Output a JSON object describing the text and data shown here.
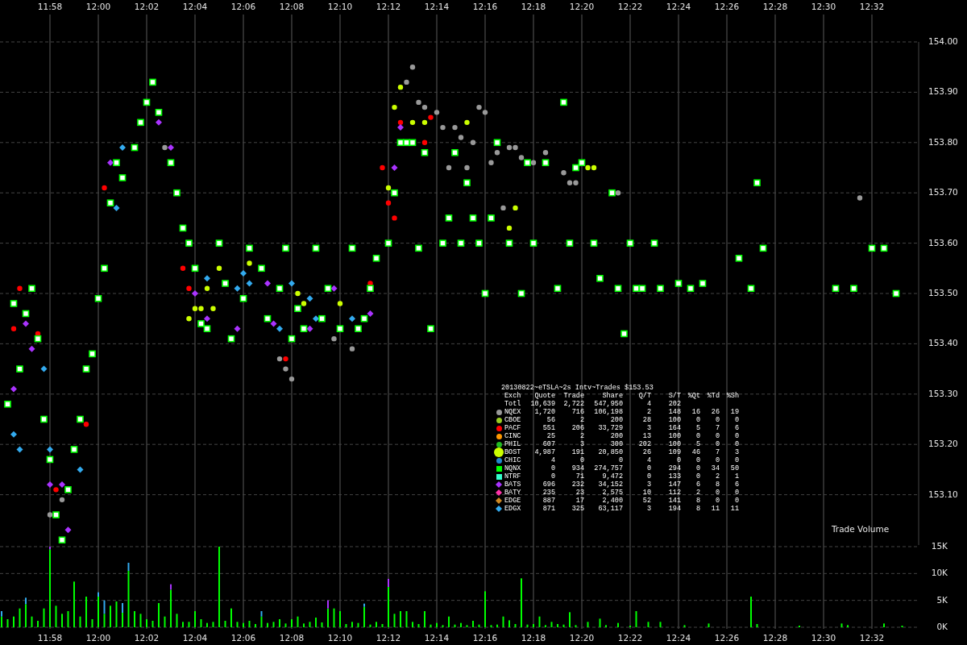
{
  "price_chart": {
    "chart_data": {
      "type": "scatter",
      "grid": true,
      "ylim": [
        153.0,
        154.0
      ],
      "categories": [
        null,
        null,
        null,
        null,
        null,
        null,
        null,
        null,
        "11:58",
        null,
        null,
        null,
        null,
        null,
        null,
        null,
        "12:00",
        null,
        null,
        null,
        null,
        null,
        null,
        null,
        "12:02",
        null,
        null,
        null,
        null,
        null,
        null,
        null,
        "12:04",
        null,
        null,
        null,
        null,
        null,
        null,
        null,
        "12:06",
        null,
        null,
        null,
        null,
        null,
        null,
        null,
        "12:08",
        null,
        null,
        null,
        null,
        null,
        null,
        null,
        "12:10",
        null,
        null,
        null,
        null,
        null,
        null,
        null,
        "12:12",
        null,
        null,
        null,
        null,
        null,
        null,
        null,
        "12:14",
        null,
        null,
        null,
        null,
        null,
        null,
        null,
        "12:16",
        null,
        null,
        null,
        null,
        null,
        null,
        null,
        "12:18",
        null,
        null,
        null,
        null,
        null,
        null,
        null,
        "12:20",
        null,
        null,
        null,
        null,
        null,
        null,
        null,
        "12:22",
        null,
        null,
        null,
        null,
        null,
        null,
        null,
        "12:24",
        null,
        null,
        null,
        null,
        null,
        null,
        null,
        "12:26",
        null,
        null,
        null,
        null,
        null,
        null,
        null,
        "12:28",
        null,
        null,
        null,
        null,
        null,
        null,
        null,
        "12:30",
        null,
        null,
        null,
        null,
        null,
        null,
        null,
        "12:32",
        null,
        null,
        null,
        null,
        null,
        null,
        null
      ],
      "yticks": [
        {
          "value": 154.0,
          "label": "154.00"
        },
        {
          "value": 153.9,
          "label": "153.90"
        },
        {
          "value": 153.8,
          "label": "153.80"
        },
        {
          "value": 153.7,
          "label": "153.70"
        },
        {
          "value": 153.6,
          "label": "153.60"
        },
        {
          "value": 153.5,
          "label": "153.50"
        },
        {
          "value": 153.4,
          "label": "153.40"
        },
        {
          "value": 153.3,
          "label": "153.30"
        },
        {
          "value": 153.2,
          "label": "153.20"
        },
        {
          "value": 153.1,
          "label": "153.10"
        }
      ],
      "series": [
        {
          "color": "#999999",
          "marker": "circle",
          "values": [
            null,
            null,
            null,
            null,
            null,
            null,
            null,
            null,
            153.06,
            null,
            153.09,
            null,
            null,
            null,
            null,
            null,
            null,
            null,
            null,
            null,
            null,
            null,
            null,
            null,
            null,
            null,
            null,
            153.79,
            null,
            null,
            null,
            null,
            null,
            null,
            null,
            null,
            null,
            null,
            null,
            null,
            null,
            null,
            null,
            null,
            null,
            null,
            153.37,
            153.35,
            153.33,
            null,
            null,
            null,
            null,
            null,
            null,
            153.41,
            null,
            null,
            153.39,
            null,
            null,
            null,
            null,
            null,
            null,
            null,
            null,
            153.92,
            153.95,
            153.88,
            153.87,
            null,
            153.86,
            153.83,
            153.75,
            153.83,
            153.81,
            153.75,
            153.8,
            153.87,
            153.86,
            153.76,
            153.78,
            153.67,
            153.79,
            153.79,
            153.77,
            null,
            153.76,
            null,
            153.78,
            null,
            null,
            153.74,
            153.72,
            153.72,
            null,
            null,
            null,
            null,
            null,
            null,
            153.7,
            null,
            null,
            null,
            null,
            null,
            null,
            null,
            null,
            null,
            null,
            null,
            null,
            null,
            null,
            null,
            null,
            null,
            null,
            null,
            null,
            null,
            null,
            null,
            null,
            null,
            null,
            null,
            null,
            null,
            null,
            null,
            null,
            null,
            null,
            null,
            null,
            null,
            null,
            null,
            153.69,
            null,
            null,
            null,
            null,
            null,
            null,
            null,
            null,
            null
          ]
        },
        {
          "color": "#ff0000",
          "marker": "circle",
          "values": [
            null,
            null,
            153.43,
            153.51,
            null,
            null,
            153.42,
            null,
            null,
            153.11,
            null,
            null,
            null,
            null,
            153.24,
            null,
            null,
            153.71,
            null,
            null,
            null,
            null,
            null,
            null,
            null,
            null,
            null,
            null,
            null,
            null,
            153.55,
            153.51,
            null,
            null,
            null,
            null,
            null,
            null,
            null,
            null,
            null,
            null,
            null,
            null,
            null,
            null,
            null,
            153.37,
            null,
            null,
            null,
            null,
            null,
            null,
            null,
            null,
            null,
            null,
            null,
            null,
            null,
            153.52,
            null,
            153.75,
            153.68,
            153.65,
            153.84,
            null,
            null,
            null,
            153.8,
            153.85,
            null,
            null,
            null,
            null,
            null,
            null,
            null,
            null,
            null,
            null,
            null,
            null,
            null,
            null,
            null,
            null,
            null,
            null,
            null,
            null,
            null,
            null,
            null,
            null,
            null,
            null,
            null,
            null,
            null,
            null,
            null,
            null,
            null,
            null,
            null,
            null,
            null,
            null,
            null,
            null,
            null,
            null,
            null,
            null,
            null,
            null,
            null,
            null,
            null,
            null,
            null,
            null,
            null,
            null,
            null,
            null,
            null,
            null,
            null,
            null,
            null,
            null,
            null,
            null,
            null,
            null,
            null,
            null,
            null,
            null,
            null,
            null,
            null,
            null,
            null,
            null,
            null,
            null,
            null,
            null
          ]
        },
        {
          "color": "#ccff00",
          "marker": "circle",
          "values": [
            null,
            null,
            null,
            null,
            null,
            null,
            null,
            null,
            null,
            null,
            null,
            null,
            null,
            null,
            null,
            null,
            null,
            null,
            null,
            null,
            null,
            null,
            null,
            null,
            null,
            null,
            null,
            null,
            null,
            null,
            null,
            153.45,
            153.47,
            153.47,
            153.51,
            153.47,
            153.55,
            null,
            null,
            null,
            null,
            153.56,
            null,
            null,
            null,
            null,
            null,
            null,
            null,
            153.5,
            153.48,
            null,
            null,
            null,
            null,
            null,
            153.48,
            null,
            null,
            null,
            null,
            null,
            null,
            null,
            153.71,
            153.87,
            153.91,
            null,
            153.84,
            null,
            153.84,
            null,
            null,
            null,
            null,
            null,
            null,
            153.84,
            null,
            null,
            null,
            null,
            null,
            null,
            153.63,
            153.67,
            null,
            null,
            null,
            null,
            null,
            null,
            null,
            null,
            null,
            null,
            null,
            153.75,
            153.75,
            null,
            null,
            null,
            null,
            null,
            null,
            null,
            null,
            null,
            null,
            null,
            null,
            null,
            null,
            null,
            null,
            null,
            null,
            null,
            null,
            null,
            null,
            null,
            null,
            null,
            null,
            null,
            null,
            null,
            null,
            null,
            null,
            null,
            null,
            null,
            null,
            null,
            null,
            null,
            null,
            null,
            null,
            null,
            null,
            null,
            null,
            null,
            null,
            null,
            null,
            null,
            null,
            null
          ]
        },
        {
          "color": "#aa33ff",
          "marker": "diamond",
          "values": [
            null,
            null,
            153.31,
            null,
            153.44,
            153.39,
            null,
            null,
            153.12,
            null,
            153.12,
            153.03,
            null,
            null,
            null,
            null,
            null,
            null,
            153.76,
            null,
            null,
            null,
            null,
            null,
            null,
            null,
            153.84,
            null,
            153.79,
            null,
            null,
            null,
            153.5,
            null,
            153.45,
            null,
            null,
            null,
            null,
            153.43,
            null,
            null,
            null,
            null,
            153.52,
            153.44,
            null,
            null,
            null,
            null,
            null,
            153.43,
            null,
            null,
            null,
            153.51,
            null,
            null,
            null,
            null,
            null,
            153.46,
            null,
            null,
            null,
            153.75,
            153.83,
            null,
            null,
            null,
            null,
            null,
            null,
            null,
            null,
            null,
            null,
            null,
            null,
            null,
            null,
            null,
            null,
            null,
            null,
            null,
            null,
            null,
            null,
            null,
            null,
            null,
            null,
            null,
            null,
            null,
            null,
            null,
            null,
            null,
            null,
            null,
            null,
            null,
            null,
            null,
            null,
            null,
            null,
            null,
            null,
            null,
            null,
            null,
            null,
            null,
            null,
            null,
            null,
            null,
            null,
            null,
            null,
            null,
            null,
            null,
            null,
            null,
            null,
            null,
            null,
            null,
            null,
            null,
            null,
            null,
            null,
            null,
            null,
            null,
            null,
            null,
            null,
            null,
            null,
            null,
            null,
            null,
            null,
            null,
            null,
            null
          ]
        },
        {
          "color": "#33aaee",
          "marker": "diamond",
          "values": [
            null,
            null,
            153.22,
            153.19,
            null,
            null,
            null,
            153.35,
            153.19,
            null,
            null,
            null,
            null,
            153.15,
            null,
            null,
            null,
            null,
            null,
            153.67,
            153.79,
            null,
            null,
            null,
            null,
            null,
            null,
            null,
            null,
            null,
            null,
            null,
            null,
            null,
            153.53,
            null,
            null,
            null,
            null,
            153.51,
            153.54,
            153.52,
            null,
            null,
            null,
            null,
            153.43,
            null,
            153.52,
            null,
            null,
            153.49,
            153.45,
            null,
            null,
            null,
            null,
            null,
            153.45,
            null,
            null,
            null,
            null,
            null,
            null,
            null,
            null,
            null,
            null,
            null,
            null,
            null,
            null,
            null,
            null,
            null,
            null,
            null,
            null,
            null,
            null,
            null,
            null,
            null,
            null,
            null,
            null,
            null,
            null,
            null,
            null,
            null,
            null,
            null,
            null,
            null,
            null,
            null,
            null,
            null,
            null,
            null,
            null,
            null,
            null,
            null,
            null,
            null,
            null,
            null,
            null,
            null,
            null,
            null,
            null,
            null,
            null,
            null,
            null,
            null,
            null,
            null,
            null,
            null,
            null,
            null,
            null,
            null,
            null,
            null,
            null,
            null,
            null,
            null,
            null,
            null,
            null,
            null,
            null,
            null,
            null,
            null,
            null,
            null,
            null,
            null,
            null,
            null,
            null,
            null,
            null,
            null
          ]
        },
        {
          "color": "#00ff00",
          "marker": "square",
          "values": [
            null,
            153.28,
            153.48,
            153.35,
            153.46,
            153.51,
            153.41,
            153.25,
            153.17,
            153.06,
            153.01,
            153.11,
            153.19,
            153.25,
            153.35,
            153.38,
            153.49,
            153.55,
            153.68,
            153.76,
            153.73,
            null,
            153.79,
            153.84,
            153.88,
            153.92,
            153.86,
            null,
            153.76,
            153.7,
            153.63,
            153.6,
            153.55,
            153.44,
            153.43,
            null,
            153.6,
            153.52,
            153.41,
            null,
            153.49,
            153.59,
            null,
            153.55,
            153.45,
            null,
            153.51,
            153.59,
            153.41,
            153.47,
            153.43,
            null,
            153.59,
            153.45,
            153.51,
            null,
            153.43,
            null,
            153.59,
            153.43,
            153.45,
            153.51,
            153.57,
            null,
            153.6,
            153.7,
            153.8,
            153.8,
            153.8,
            153.59,
            153.78,
            153.43,
            null,
            153.6,
            153.65,
            153.78,
            153.6,
            153.72,
            153.65,
            153.6,
            153.5,
            153.65,
            153.8,
            null,
            153.6,
            null,
            153.5,
            153.76,
            153.6,
            null,
            153.76,
            null,
            153.51,
            153.88,
            153.6,
            153.75,
            153.76,
            null,
            153.6,
            153.53,
            null,
            153.7,
            153.51,
            153.42,
            153.6,
            153.51,
            153.51,
            null,
            153.6,
            153.51,
            null,
            null,
            153.52,
            null,
            153.51,
            null,
            153.52,
            null,
            null,
            null,
            null,
            null,
            153.57,
            null,
            153.51,
            153.72,
            153.59,
            null,
            null,
            null,
            null,
            null,
            null,
            null,
            null,
            null,
            null,
            null,
            153.51,
            null,
            null,
            153.51,
            null,
            null,
            153.59,
            null,
            153.59,
            null,
            153.5,
            null,
            null,
            null
          ]
        }
      ]
    }
  },
  "legend_table": {
    "title": "20130822~eTSLA~2s Intv~Trades $153.53",
    "columns": [
      "Exch",
      "Quote",
      "Trade",
      "Share",
      "Q/T",
      "S/T",
      "%Qt",
      "%Td",
      "%Sh"
    ],
    "total_row": [
      "Totl",
      "10,639",
      "2,722",
      "547,950",
      "4",
      "202"
    ],
    "rows": [
      {
        "kind": "circle",
        "color": "#999999",
        "cells": [
          "NQEX",
          "1,720",
          "716",
          "106,198",
          "2",
          "148",
          "16",
          "26",
          "19"
        ]
      },
      {
        "kind": "circle",
        "color": "#99cc22",
        "cells": [
          "CBOE",
          "56",
          "2",
          "200",
          "28",
          "100",
          "0",
          "0",
          "0"
        ]
      },
      {
        "kind": "circle",
        "color": "#ff0000",
        "cells": [
          "PACF",
          "551",
          "206",
          "33,729",
          "3",
          "164",
          "5",
          "7",
          "6"
        ]
      },
      {
        "kind": "circle",
        "color": "#ff9900",
        "cells": [
          "CINC",
          "25",
          "2",
          "200",
          "13",
          "100",
          "0",
          "0",
          "0"
        ]
      },
      {
        "kind": "circle",
        "color": "#22bb22",
        "cells": [
          "PHIL",
          "607",
          "3",
          "300",
          "202",
          "100",
          "5",
          "0",
          "0"
        ]
      },
      {
        "kind": "bigcircle",
        "color": "#ccff00",
        "cells": [
          "BOST",
          "4,987",
          "191",
          "20,850",
          "26",
          "109",
          "46",
          "7",
          "3"
        ]
      },
      {
        "kind": "circle",
        "color": "#2288cc",
        "cells": [
          "CHIC",
          "4",
          "0",
          "0",
          "4",
          "0",
          "0",
          "0",
          "0"
        ]
      },
      {
        "kind": "square",
        "color": "#00ff00",
        "cells": [
          "NQNX",
          "0",
          "934",
          "274,757",
          "0",
          "294",
          "0",
          "34",
          "50"
        ]
      },
      {
        "kind": "square",
        "color": "#33ffcc",
        "cells": [
          "NTRF",
          "0",
          "71",
          "9,472",
          "0",
          "133",
          "0",
          "2",
          "1"
        ]
      },
      {
        "kind": "diamond",
        "color": "#aa33ff",
        "cells": [
          "BATS",
          "696",
          "232",
          "34,152",
          "3",
          "147",
          "6",
          "8",
          "6"
        ]
      },
      {
        "kind": "diamond",
        "color": "#ff33aa",
        "cells": [
          "BATY",
          "235",
          "23",
          "2,575",
          "10",
          "112",
          "2",
          "0",
          "0"
        ]
      },
      {
        "kind": "diamond",
        "color": "#cc8822",
        "cells": [
          "EDGE",
          "887",
          "17",
          "2,400",
          "52",
          "141",
          "8",
          "0",
          "0"
        ]
      },
      {
        "kind": "diamond",
        "color": "#33aaee",
        "cells": [
          "EDGX",
          "871",
          "325",
          "63,117",
          "3",
          "194",
          "8",
          "11",
          "11"
        ]
      }
    ]
  },
  "volume_chart": {
    "chart_data": {
      "type": "bar",
      "title": "Trade Volume",
      "stacked": true,
      "grid": true,
      "ylim": [
        0,
        15
      ],
      "categories": [
        null,
        null,
        null,
        null,
        null,
        null,
        null,
        null,
        "11:58",
        null,
        null,
        null,
        null,
        null,
        null,
        null,
        "12:00",
        null,
        null,
        null,
        null,
        null,
        null,
        null,
        "12:02",
        null,
        null,
        null,
        null,
        null,
        null,
        null,
        "12:04",
        null,
        null,
        null,
        null,
        null,
        null,
        null,
        "12:06",
        null,
        null,
        null,
        null,
        null,
        null,
        null,
        "12:08",
        null,
        null,
        null,
        null,
        null,
        null,
        null,
        "12:10",
        null,
        null,
        null,
        null,
        null,
        null,
        null,
        "12:12",
        null,
        null,
        null,
        null,
        null,
        null,
        null,
        "12:14",
        null,
        null,
        null,
        null,
        null,
        null,
        null,
        "12:16",
        null,
        null,
        null,
        null,
        null,
        null,
        null,
        "12:18",
        null,
        null,
        null,
        null,
        null,
        null,
        null,
        "12:20",
        null,
        null,
        null,
        null,
        null,
        null,
        null,
        "12:22",
        null,
        null,
        null,
        null,
        null,
        null,
        null,
        "12:24",
        null,
        null,
        null,
        null,
        null,
        null,
        null,
        "12:26",
        null,
        null,
        null,
        null,
        null,
        null,
        null,
        "12:28",
        null,
        null,
        null,
        null,
        null,
        null,
        null,
        "12:30",
        null,
        null,
        null,
        null,
        null,
        null,
        null,
        "12:32",
        null,
        null,
        null,
        null,
        null,
        null,
        null
      ],
      "yticks": [
        {
          "value": 0,
          "label": "0K"
        },
        {
          "value": 5,
          "label": "5K"
        },
        {
          "value": 10,
          "label": "10K"
        },
        {
          "value": 15,
          "label": "15K"
        }
      ],
      "series": [
        {
          "color": "#00ff00",
          "values": [
            2.0,
            1.5,
            2.0,
            3.5,
            4.3,
            2.0,
            1.2,
            3.5,
            14.5,
            4.0,
            2.5,
            3.0,
            8.5,
            2.0,
            5.7,
            1.5,
            5.7,
            2.5,
            4.0,
            4.8,
            2.7,
            10.5,
            3.0,
            2.5,
            1.5,
            1.2,
            4.5,
            2.0,
            7.0,
            2.5,
            1.0,
            1.0,
            3.0,
            1.5,
            0.8,
            1.0,
            15,
            1.2,
            3.5,
            1.0,
            0.8,
            1.2,
            0.6,
            2.0,
            0.8,
            1.0,
            1.5,
            0.7,
            1.5,
            2.0,
            0.7,
            1.0,
            1.8,
            0.9,
            3.5,
            3.5,
            3.0,
            0.6,
            1.0,
            0.8,
            3.8,
            0.5,
            1.0,
            0.6,
            7.5,
            2.5,
            3.0,
            3.0,
            1.0,
            0.6,
            3.0,
            0.5,
            0.8,
            0.4,
            2.0,
            0.5,
            0.8,
            0.4,
            1.2,
            0.5,
            6.7,
            0.4,
            0.5,
            2.0,
            1.3,
            0.6,
            9.1,
            0.5,
            0.6,
            2.0,
            0.4,
            1.0,
            0.6,
            0.5,
            2.8,
            0.4,
            null,
            1.0,
            null,
            1.6,
            0.4,
            null,
            0.8,
            null,
            0.3,
            3.0,
            null,
            1.0,
            null,
            1.0,
            null,
            null,
            null,
            0.4,
            null,
            null,
            null,
            0.7,
            null,
            null,
            null,
            null,
            null,
            null,
            5.7,
            0.6,
            null,
            null,
            null,
            null,
            null,
            null,
            0.3,
            null,
            null,
            null,
            null,
            null,
            null,
            0.7,
            0.4,
            null,
            null,
            null,
            null,
            null,
            0.7,
            null,
            null,
            0.3,
            null,
            null
          ]
        },
        {
          "color": "#33aaee",
          "values": [
            1.0,
            null,
            null,
            null,
            1.2,
            null,
            null,
            null,
            null,
            null,
            null,
            null,
            null,
            null,
            null,
            null,
            0.8,
            2.5,
            null,
            null,
            1.8,
            1.5,
            null,
            null,
            null,
            null,
            null,
            null,
            null,
            null,
            null,
            null,
            null,
            null,
            null,
            null,
            null,
            null,
            null,
            null,
            null,
            null,
            null,
            1.0,
            null,
            null,
            null,
            null,
            null,
            null,
            null,
            null,
            null,
            null,
            null,
            null,
            null,
            null,
            null,
            null,
            0.6,
            null,
            null,
            null,
            null,
            null,
            null,
            null,
            null,
            null,
            null,
            null,
            null,
            null,
            null,
            null,
            null,
            null,
            null,
            null,
            null,
            null,
            null,
            null,
            null,
            null,
            null,
            null,
            null,
            null,
            null,
            null,
            null,
            null,
            null,
            null,
            null,
            null,
            null,
            null,
            null,
            null,
            null,
            null,
            null,
            null,
            null,
            null,
            null,
            null,
            null,
            null,
            null,
            null,
            null,
            null,
            null,
            null,
            null,
            null,
            null,
            null,
            null,
            null,
            null,
            null,
            null,
            null,
            null,
            null,
            null,
            null,
            null,
            null,
            null,
            null,
            null,
            null,
            null,
            null,
            null,
            null,
            null,
            null,
            null,
            null,
            null,
            null,
            null,
            null,
            null,
            null
          ]
        },
        {
          "color": "#aa33ff",
          "values": [
            null,
            null,
            null,
            null,
            null,
            null,
            null,
            null,
            0.5,
            null,
            null,
            null,
            null,
            null,
            null,
            null,
            null,
            null,
            null,
            null,
            null,
            null,
            null,
            null,
            null,
            null,
            null,
            null,
            1.0,
            null,
            null,
            null,
            null,
            null,
            null,
            null,
            null,
            null,
            null,
            null,
            null,
            null,
            null,
            null,
            null,
            null,
            null,
            null,
            null,
            null,
            null,
            null,
            null,
            null,
            1.5,
            null,
            null,
            null,
            null,
            null,
            null,
            null,
            null,
            null,
            1.5,
            null,
            null,
            null,
            null,
            null,
            null,
            null,
            null,
            null,
            null,
            null,
            null,
            null,
            null,
            null,
            null,
            null,
            null,
            null,
            null,
            null,
            null,
            null,
            null,
            null,
            null,
            null,
            null,
            null,
            null,
            null,
            null,
            null,
            null,
            null,
            null,
            null,
            null,
            null,
            null,
            null,
            null,
            null,
            null,
            null,
            null,
            null,
            null,
            null,
            null,
            null,
            null,
            null,
            null,
            null,
            null,
            null,
            null,
            null,
            null,
            null,
            null,
            null,
            null,
            null,
            null,
            null,
            null,
            null,
            null,
            null,
            null,
            null,
            null,
            null,
            null,
            null,
            null,
            null,
            null,
            null,
            null,
            null,
            null,
            null,
            null,
            null
          ]
        }
      ]
    }
  }
}
